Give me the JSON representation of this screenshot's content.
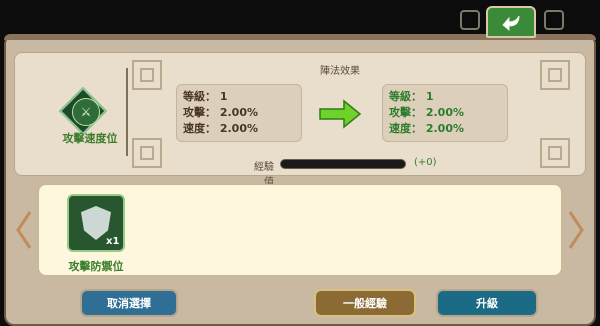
{
  "header": {
    "return_icon": "return-arrow-icon"
  },
  "enhance": {
    "title": "陣法效果",
    "formation": {
      "name": "攻擊速度位",
      "icon": "sword-emblem-icon"
    },
    "current": {
      "level": "等級： 1",
      "attack": "攻擊： 2.00%",
      "speed": "速度： 2.00%"
    },
    "next": {
      "level": "等級： 1",
      "attack": "攻擊： 2.00%",
      "speed": "速度： 2.00%"
    },
    "xp": {
      "label": "經驗值",
      "progress": 0,
      "gain": "(+0)"
    }
  },
  "materials": {
    "items": [
      {
        "name": "攻擊防禦位",
        "count": "x1",
        "icon": "shield-swords-icon"
      }
    ]
  },
  "buttons": {
    "cancel": "取消選擇",
    "normal_xp": "一般經驗",
    "upgrade": "升級"
  },
  "colors": {
    "accent_green": "#3c7e2e",
    "frame": "#c9b9a2",
    "panel": "#e9ddcb"
  }
}
